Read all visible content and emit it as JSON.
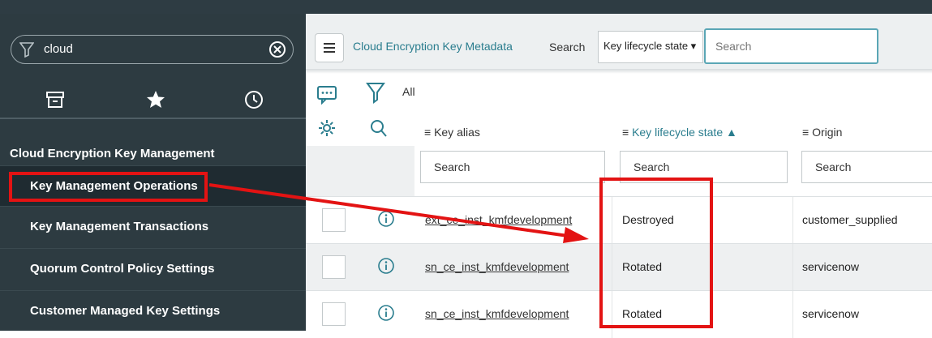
{
  "sidebar": {
    "filter_value": "cloud",
    "header": "Cloud Encryption Key Management",
    "items": [
      {
        "label": "Key Management Operations",
        "active": true
      },
      {
        "label": "Key Management Transactions"
      },
      {
        "label": "Quorum Control Policy Settings"
      },
      {
        "label": "Customer Managed Key Settings"
      }
    ]
  },
  "list": {
    "title": "Cloud Encryption Key Metadata",
    "search_label": "Search",
    "search_field_select": "Key lifecycle state ▾",
    "search_placeholder": "Search",
    "breadcrumb_all": "All",
    "columns": {
      "key_alias": "Key alias",
      "lifecycle": "Key lifecycle state ▲",
      "origin": "Origin"
    },
    "column_filter_placeholder": "Search",
    "rows": [
      {
        "alias": "ext_ce_inst_kmfdevelopment",
        "state": "Destroyed",
        "origin": "customer_supplied"
      },
      {
        "alias": "sn_ce_inst_kmfdevelopment",
        "state": "Rotated",
        "origin": "servicenow"
      },
      {
        "alias": "sn_ce_inst_kmfdevelopment",
        "state": "Rotated",
        "origin": "servicenow"
      }
    ]
  },
  "colors": {
    "sidebar_bg": "#2d3b41",
    "accent_link": "#2a7d8e",
    "annotation_red": "#e31313"
  }
}
